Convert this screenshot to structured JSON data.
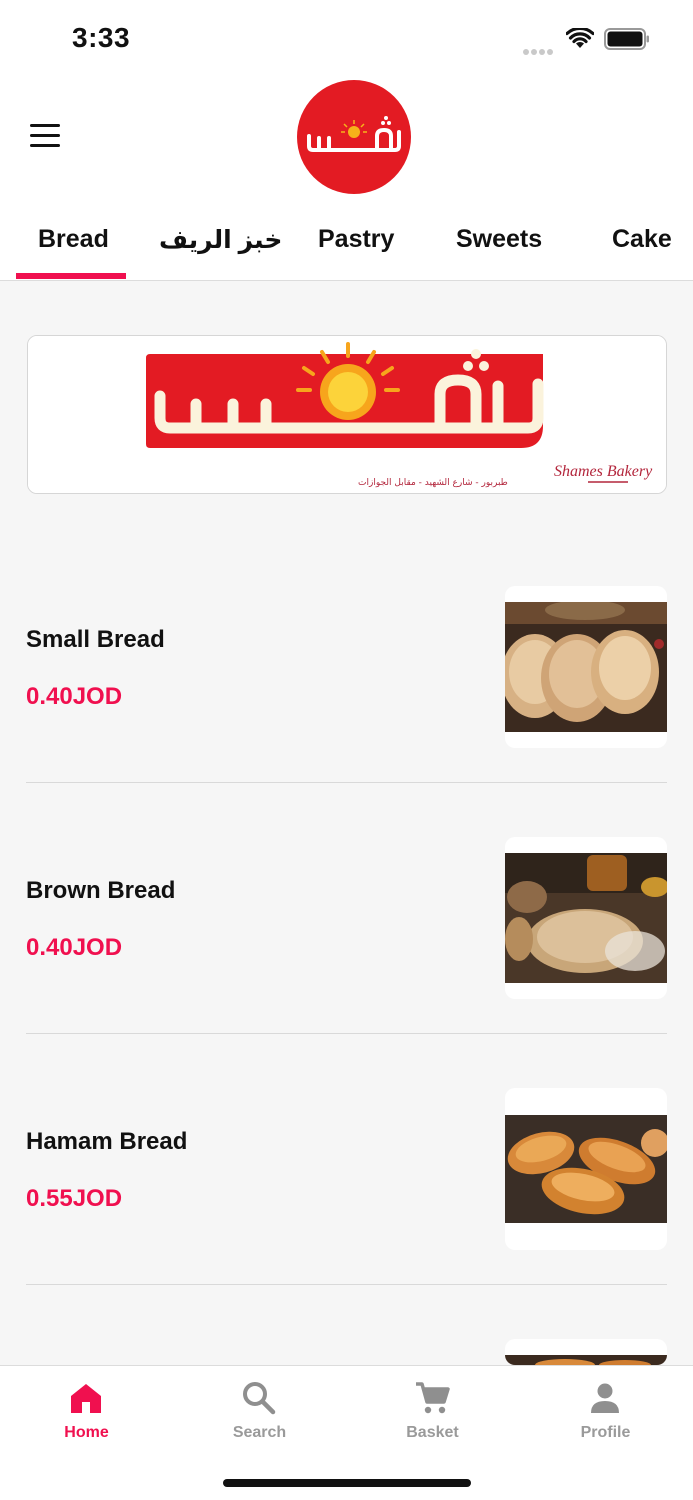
{
  "status_bar": {
    "time": "3:33"
  },
  "header": {
    "menu_icon": "hamburger-menu-icon",
    "logo_text": "شمس"
  },
  "tabs": [
    {
      "label": "Bread",
      "active": true
    },
    {
      "label": "خبز الريف",
      "active": false
    },
    {
      "label": "Pastry",
      "active": false
    },
    {
      "label": "Sweets",
      "active": false
    },
    {
      "label": "Cake",
      "active": false
    }
  ],
  "banner": {
    "logo_text": "شمس",
    "brand_script": "Shames Bakery",
    "address": "طبربور - شارع الشهيد - مقابل الجوازات"
  },
  "products": [
    {
      "name": "Small Bread",
      "price": "0.40JOD"
    },
    {
      "name": "Brown Bread",
      "price": "0.40JOD"
    },
    {
      "name": "Hamam Bread",
      "price": "0.55JOD"
    }
  ],
  "bottom_nav": [
    {
      "label": "Home",
      "icon": "home-icon",
      "active": true
    },
    {
      "label": "Search",
      "icon": "search-icon",
      "active": false
    },
    {
      "label": "Basket",
      "icon": "cart-icon",
      "active": false
    },
    {
      "label": "Profile",
      "icon": "profile-icon",
      "active": false
    }
  ],
  "colors": {
    "accent": "#f0104f",
    "brand_red": "#e31b23",
    "inactive": "#9a9a9a"
  }
}
